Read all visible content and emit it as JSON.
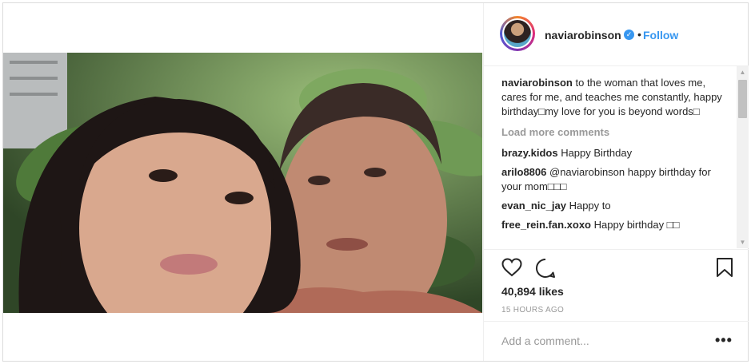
{
  "header": {
    "username": "naviarobinson",
    "verified_icon": "verified-badge-icon",
    "separator": "•",
    "follow_label": "Follow"
  },
  "caption": {
    "username": "naviarobinson",
    "text": "to the woman that loves me, cares for me, and teaches me constantly, happy birthday□my love for you is beyond words□"
  },
  "load_more_label": "Load more comments",
  "comments": [
    {
      "username": "brazy.kidos",
      "text": "Happy Birthday"
    },
    {
      "username": "arilo8806",
      "text": "@naviarobinson happy birthday for your mom□□□"
    },
    {
      "username": "evan_nic_jay",
      "text": "Happy to"
    },
    {
      "username": "free_rein.fan.xoxo",
      "text": "Happy birthday □□"
    }
  ],
  "actions": {
    "like_icon": "heart-icon",
    "comment_icon": "comment-bubble-icon",
    "save_icon": "bookmark-icon"
  },
  "likes": "40,894 likes",
  "timestamp": "15 HOURS AGO",
  "add_comment": {
    "placeholder": "Add a comment...",
    "more_label": "•••"
  },
  "colors": {
    "link_blue": "#3897f0",
    "muted_gray": "#999999",
    "text": "#262626"
  }
}
